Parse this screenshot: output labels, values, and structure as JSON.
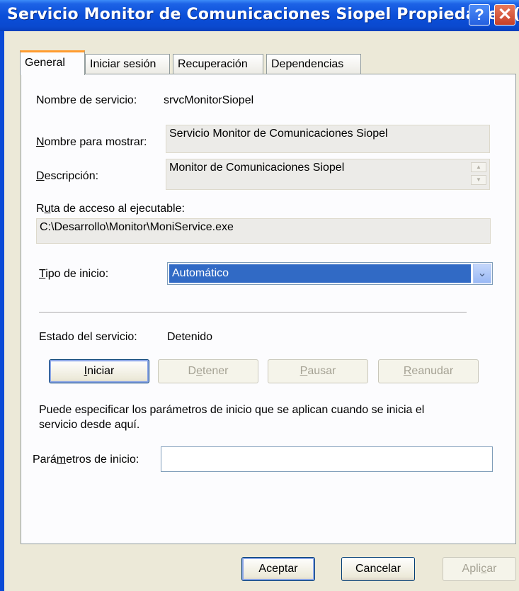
{
  "window": {
    "title": "Servicio Monitor de Comunicaciones Siopel Propiedades (...",
    "help_glyph": "?",
    "close_glyph": "✕"
  },
  "tabs": [
    {
      "label": "General"
    },
    {
      "label": "Iniciar sesión"
    },
    {
      "label": "Recuperación"
    },
    {
      "label": "Dependencias"
    }
  ],
  "general": {
    "service_name_label": "Nombre de servicio:",
    "service_name_value": "srvcMonitorSiopel",
    "display_name_label": {
      "key": "N",
      "rest": "ombre para mostrar:"
    },
    "display_name_value": "Servicio Monitor de Comunicaciones Siopel",
    "description_label": {
      "key": "D",
      "rest": "escripción:"
    },
    "description_value": "Monitor de Comunicaciones Siopel",
    "exe_path_label": {
      "pre": "R",
      "key": "u",
      "rest": "ta de acceso al ejecutable:"
    },
    "exe_path_value": "C:\\Desarrollo\\Monitor\\MoniService.exe",
    "startup_type_label": {
      "key": "T",
      "rest": "ipo de inicio:"
    },
    "startup_type_value": "Automático",
    "status_label": "Estado del servicio:",
    "status_value": "Detenido",
    "buttons": {
      "start": {
        "key": "I",
        "rest": "niciar"
      },
      "stop": {
        "pre": "D",
        "key": "e",
        "rest": "tener"
      },
      "pause": {
        "key": "P",
        "rest": "ausar"
      },
      "resume": {
        "key": "R",
        "rest": "eanudar"
      }
    },
    "hint_line1": "Puede especificar los parámetros de inicio que se aplican cuando se inicia el",
    "hint_line2": "servicio desde aquí.",
    "params_label": {
      "pre": "Pará",
      "key": "m",
      "rest": "etros de inicio:"
    },
    "params_value": ""
  },
  "footer": {
    "ok": "Aceptar",
    "cancel": "Cancelar",
    "apply": {
      "pre": "Apli",
      "key": "c",
      "rest": "ar"
    }
  }
}
